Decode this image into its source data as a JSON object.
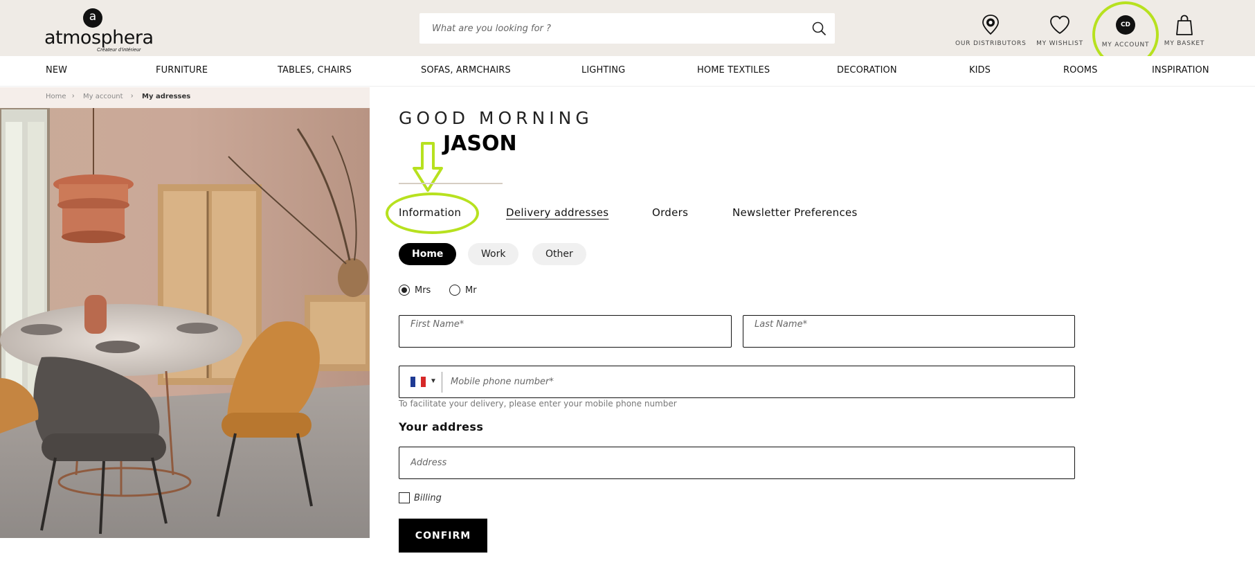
{
  "header": {
    "logo_text": "atmosphera",
    "logo_tagline": "Créateur d'intérieur",
    "search_placeholder": "What are you looking for ?",
    "search_icon": "search-icon",
    "distributors_label": "OUR DISTRIBUTORS",
    "wishlist_label": "MY WISHLIST",
    "account_label": "MY ACCOUNT",
    "account_initials": "CD",
    "basket_label": "MY BASKET",
    "highlight_color": "#b7e11f"
  },
  "nav": {
    "items": [
      "NEW",
      "FURNITURE",
      "TABLES, CHAIRS",
      "SOFAS, ARMCHAIRS",
      "LIGHTING",
      "HOME TEXTILES",
      "DECORATION",
      "KIDS",
      "ROOMS",
      "INSPIRATION"
    ]
  },
  "breadcrumb": {
    "home": "Home",
    "account": "My account",
    "current": "My adresses",
    "separator": "›"
  },
  "greeting": {
    "title": "GOOD MORNING",
    "name": "JASON"
  },
  "tabs": {
    "information": "Information",
    "delivery": "Delivery addresses",
    "orders": "Orders",
    "newsletter": "Newsletter Preferences"
  },
  "address_type": {
    "home": "Home",
    "work": "Work",
    "other": "Other",
    "selected": "Home"
  },
  "title_choice": {
    "mrs": "Mrs",
    "mr": "Mr",
    "selected": "Mrs"
  },
  "form": {
    "first_name_placeholder": "First Name*",
    "last_name_placeholder": "Last Name*",
    "phone_placeholder": "Mobile phone number*",
    "phone_hint": "To facilitate your delivery, please enter your mobile phone number",
    "address_section_title": "Your address",
    "address_placeholder": "Address",
    "billing_label": "Billing",
    "confirm_label": "CONFIRM",
    "flag_colors": [
      "#1f3a93",
      "#ffffff",
      "#d62828"
    ]
  }
}
